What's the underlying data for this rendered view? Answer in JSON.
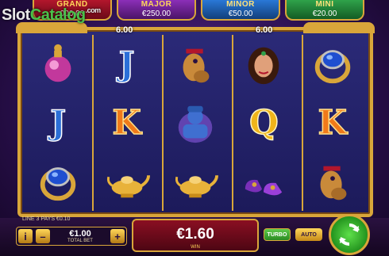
{
  "watermark": {
    "slot": "Slot",
    "catalog": "Catalog",
    "com": ".com"
  },
  "jackpots": [
    {
      "name": "GRAND",
      "value": "000.00"
    },
    {
      "name": "MAJOR",
      "value": "€250.00"
    },
    {
      "name": "MINOR",
      "value": "€50.00"
    },
    {
      "name": "MINI",
      "value": "€20.00"
    }
  ],
  "multipliers": [
    "6.00",
    "6.00"
  ],
  "reels": [
    [
      "perfume-bottle",
      "J",
      "camel",
      "princess",
      "sapphire-ring"
    ],
    [
      "J",
      "K",
      "genie",
      "Q",
      "K"
    ],
    [
      "sapphire-ring",
      "magic-lamp",
      "magic-lamp",
      "slippers",
      "camel"
    ]
  ],
  "status": {
    "payline": "LINE 3 PAYS €0.10"
  },
  "bet": {
    "value": "€1.00",
    "label": "TOTAL BET",
    "info": "i",
    "minus": "–",
    "plus": "+"
  },
  "win": {
    "amount": "€1.60",
    "label": "WIN"
  },
  "buttons": {
    "turbo": "TURBO",
    "auto": "AUTO"
  },
  "colors": {
    "gold": "#d9a63a",
    "spin": "#2fb52a",
    "win_panel": "#8a0f22"
  }
}
